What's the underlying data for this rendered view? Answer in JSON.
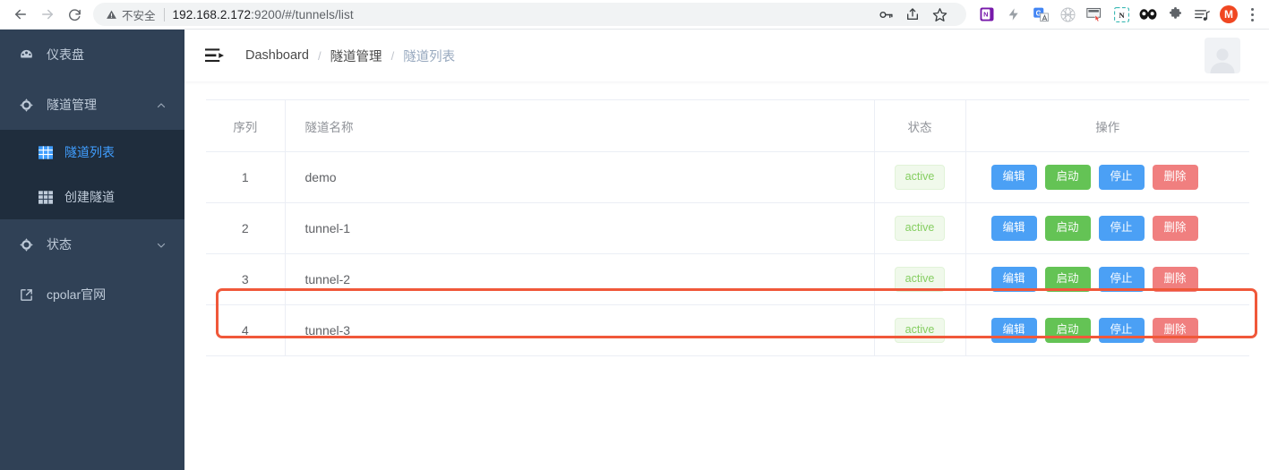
{
  "browser": {
    "back_label": "back-arrow",
    "forward_label": "forward-arrow",
    "reload_label": "reload",
    "security_text": "不安全",
    "url_main": "192.168.2.172",
    "url_rest": ":9200/#/tunnels/list",
    "full_url": "192.168.2.172:9200/#/tunnels/list",
    "profile_initial": "M",
    "accent_profile": "#f04722"
  },
  "sidebar": {
    "bg_color": "#304156",
    "active_color": "#409eff",
    "items": [
      {
        "label": "仪表盘",
        "icon": "dashboard-icon",
        "type": "link"
      },
      {
        "label": "隧道管理",
        "icon": "tunnel-icon",
        "type": "group",
        "expanded": true,
        "chevron": "chevron-up-icon"
      },
      {
        "label": "状态",
        "icon": "status-icon",
        "type": "group",
        "expanded": false,
        "chevron": "chevron-down-icon"
      },
      {
        "label": "cpolar官网",
        "icon": "external-link-icon",
        "type": "link"
      }
    ],
    "submenu": [
      {
        "label": "隧道列表",
        "icon": "table-icon",
        "active": true
      },
      {
        "label": "创建隧道",
        "icon": "grid-icon",
        "active": false
      }
    ]
  },
  "navbar": {
    "hamburger": "hamburger-icon",
    "breadcrumb": [
      "Dashboard",
      "隧道管理",
      "隧道列表"
    ],
    "separator": "/",
    "avatar": "user-avatar"
  },
  "table": {
    "columns": [
      "序列",
      "隧道名称",
      "状态",
      "操作"
    ],
    "rows": [
      {
        "seq": "1",
        "name": "demo",
        "status": "active",
        "highlighted": false
      },
      {
        "seq": "2",
        "name": "tunnel-1",
        "status": "active",
        "highlighted": false
      },
      {
        "seq": "3",
        "name": "tunnel-2",
        "status": "active",
        "highlighted": false
      },
      {
        "seq": "4",
        "name": "tunnel-3",
        "status": "active",
        "highlighted": true
      }
    ],
    "actions": [
      {
        "label": "编辑",
        "style": "primary",
        "color": "#4ba0f5"
      },
      {
        "label": "启动",
        "style": "success",
        "color": "#64c355"
      },
      {
        "label": "停止",
        "style": "stop",
        "color": "#4ba0f5"
      },
      {
        "label": "删除",
        "style": "danger",
        "color": "#f07f7f"
      }
    ],
    "highlight_color": "#f0583a",
    "badge_bg": "#f0f9eb",
    "badge_color": "#85ce61"
  }
}
